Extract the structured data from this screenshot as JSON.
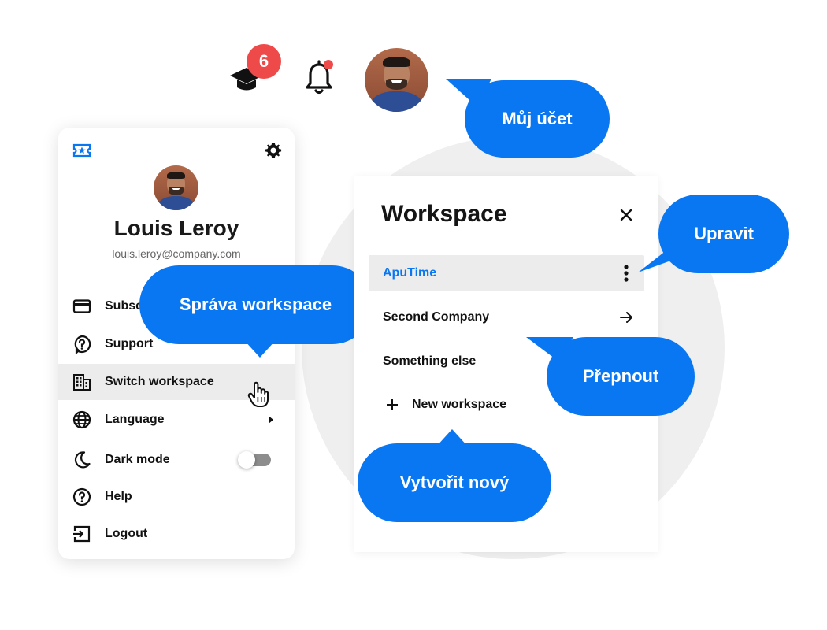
{
  "header": {
    "badge_count": "6",
    "icons": [
      "graduation-cap-icon",
      "bell-icon"
    ]
  },
  "bubbles": {
    "account": "Můj účet",
    "manage_workspace": "Správa workspace",
    "edit": "Upravit",
    "switch": "Přepnout",
    "create_new": "Vytvořit nový"
  },
  "profile_menu": {
    "name": "Louis Leroy",
    "email": "louis.leroy@company.com",
    "items": [
      {
        "label": "Subscription",
        "icon": "credit-card-icon"
      },
      {
        "label": "Support",
        "icon": "help-bubble-icon"
      },
      {
        "label": "Switch workspace",
        "icon": "building-icon",
        "active": true
      },
      {
        "label": "Language",
        "icon": "globe-icon"
      },
      {
        "label": "Dark mode",
        "icon": "moon-icon",
        "toggle": false
      },
      {
        "label": "Help",
        "icon": "help-circle-icon"
      },
      {
        "label": "Logout",
        "icon": "logout-icon"
      }
    ],
    "partial_label": "Subsc"
  },
  "workspace_panel": {
    "title": "Workspace",
    "items": [
      {
        "label": "ApuTime",
        "selected": true
      },
      {
        "label": "Second Company"
      },
      {
        "label": "Something else"
      }
    ],
    "new_label": "New workspace"
  },
  "colors": {
    "accent": "#0a77f2",
    "badge": "#ef4a4a",
    "active_row": "#ececec"
  }
}
